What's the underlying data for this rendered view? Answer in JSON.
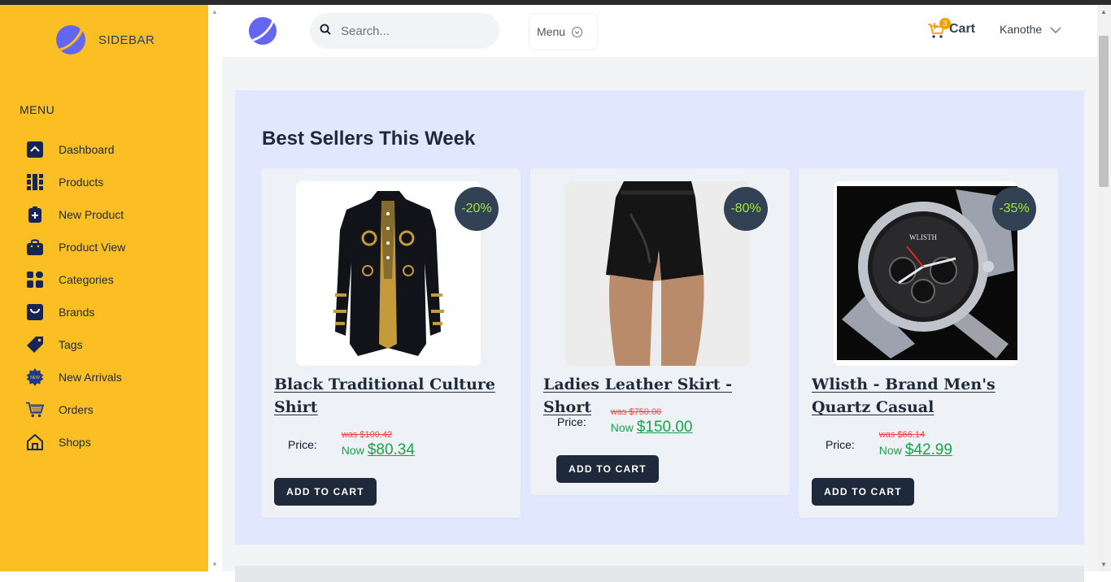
{
  "sidebar": {
    "brand": "SIDEBAR",
    "menu_heading": "MENU",
    "items": [
      {
        "label": "Dashboard",
        "icon": "chevron-up-square-icon"
      },
      {
        "label": "Products",
        "icon": "grid-icon"
      },
      {
        "label": "New Product",
        "icon": "clipboard-plus-icon"
      },
      {
        "label": "Product View",
        "icon": "bag-icon"
      },
      {
        "label": "Categories",
        "icon": "categories-icon"
      },
      {
        "label": "Brands",
        "icon": "brand-bag-icon"
      },
      {
        "label": "Tags",
        "icon": "tag-icon"
      },
      {
        "label": "New Arrivals",
        "icon": "new-badge-icon"
      },
      {
        "label": "Orders",
        "icon": "shopping-cart-icon"
      },
      {
        "label": "Shops",
        "icon": "home-icon"
      }
    ]
  },
  "header": {
    "search_placeholder": "Search...",
    "menu_label": "Menu",
    "cart_label": "Cart",
    "cart_count": "3",
    "user_name": "Kanothe"
  },
  "section": {
    "title": "Best Sellers This Week"
  },
  "products": [
    {
      "title": "Black Traditional Culture Shirt",
      "discount": "-20%",
      "price_label": "Price:",
      "was": "was $100.42",
      "now_label": "Now",
      "now_price": "$80.34",
      "button": "ADD TO CART",
      "image": "shirt"
    },
    {
      "title": "Ladies Leather Skirt - Short",
      "discount": "-80%",
      "price_label": "Price:",
      "was": "was $750.00",
      "now_label": "Now",
      "now_price": "$150.00",
      "button": "ADD TO CART",
      "image": "skirt"
    },
    {
      "title": "Wlisth - Brand Men's Quartz Casual",
      "discount": "-35%",
      "price_label": "Price:",
      "was": "was $66.14",
      "now_label": "Now",
      "now_price": "$42.99",
      "button": "ADD TO CART",
      "image": "watch"
    }
  ],
  "colors": {
    "sidebar_bg": "#fbbf24",
    "section_bg": "#e0e7ff",
    "button_bg": "#1e293b",
    "badge_bg": "#334155",
    "badge_text": "#a3e635",
    "was_price": "#ef4444",
    "now_price": "#16a34a"
  }
}
